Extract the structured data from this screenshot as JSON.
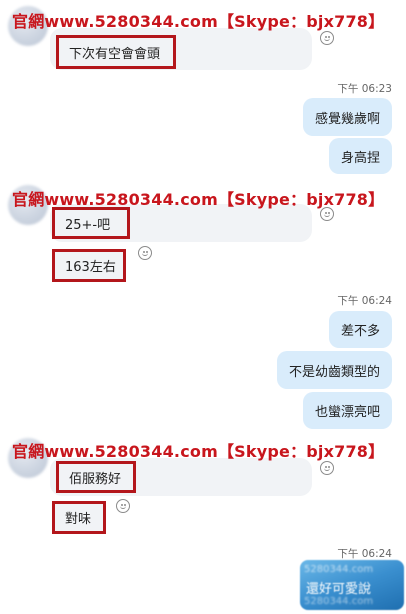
{
  "watermark": "官網www.5280344.com【Skype：bjx778】",
  "groups": [
    {
      "incoming": [
        "下次有空會會頭"
      ]
    },
    {
      "time": "下午 06:23",
      "outgoing": [
        "感覺幾歲啊",
        "身高捏"
      ]
    },
    {
      "incoming": [
        "25+-吧",
        "163左右"
      ]
    },
    {
      "time": "下午 06:24",
      "outgoing": [
        "差不多",
        "不是幼齒類型的",
        "也蠻漂亮吧"
      ]
    },
    {
      "incoming": [
        "佰服務好",
        "對味"
      ]
    },
    {
      "time": "下午 06:24",
      "outgoing_blurred": {
        "text": "還好可愛說",
        "ghost_top": "5280344.com",
        "ghost_bottom": "5280344.com"
      }
    }
  ],
  "icons": {
    "avatar": "avatar-blurred",
    "emoji": "smile-icon"
  }
}
